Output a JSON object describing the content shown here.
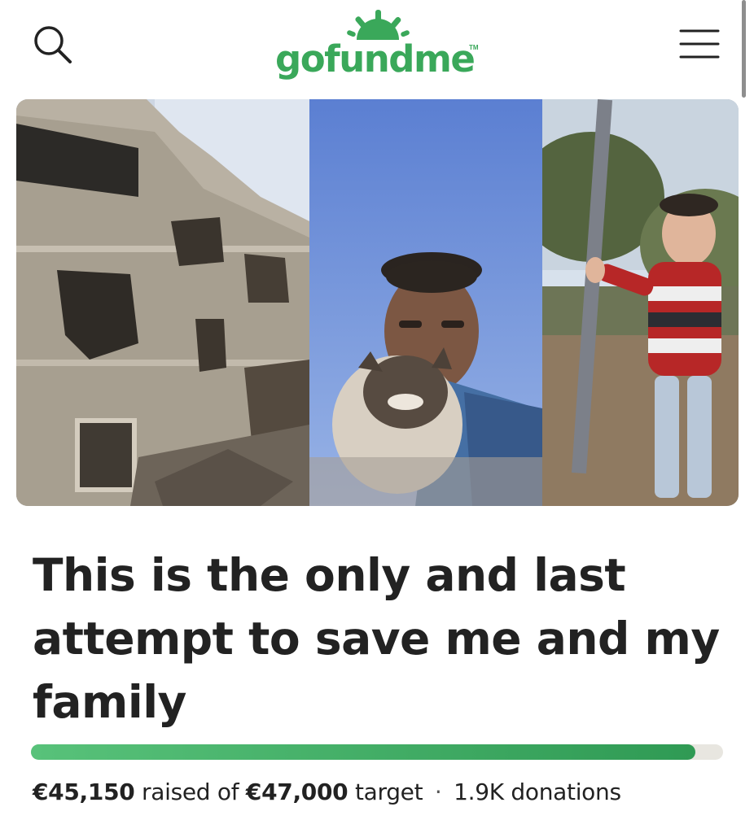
{
  "header": {
    "logo_text": "gofundme",
    "logo_tm": "TM",
    "search_icon": "search-icon",
    "menu_icon": "hamburger-menu-icon",
    "brand_color": "#3aa85a"
  },
  "campaign": {
    "title": "This is the only and last attempt to save me and my family",
    "images": [
      "destroyed-building-photo",
      "man-with-cat-selfie-photo",
      "child-in-striped-sweater-photo"
    ],
    "progress": {
      "raised_label": "€45,150",
      "raised_text": "raised of",
      "target_label": "€47,000",
      "target_text": "target",
      "separator": "·",
      "donations_label": "1.9K donations",
      "raised_value": 45150,
      "target_value": 47000,
      "fill_fraction": 0.96
    }
  }
}
